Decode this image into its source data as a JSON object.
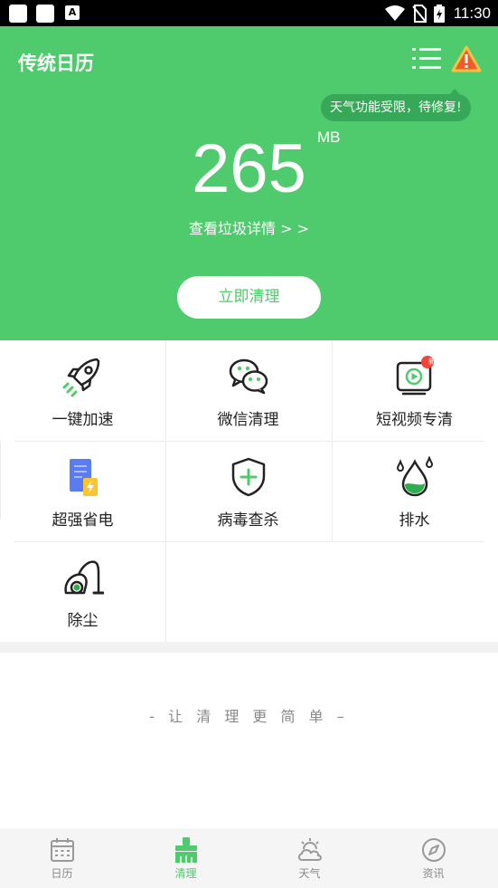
{
  "status_bar": {
    "time": "11:30",
    "icons": [
      "notification-square-icon",
      "notification-square-icon",
      "a-box-icon",
      "wifi-icon",
      "no-sim-icon",
      "battery-charging-icon"
    ]
  },
  "header": {
    "app_title": "传统日历",
    "tooltip": "天气功能受限，待修复!",
    "junk_size": "265",
    "junk_unit": "MB",
    "view_details": "查看垃圾详情 > >",
    "clean_button": "立即清理",
    "accent_color": "#4fca6c",
    "warning_color": "#f15a29"
  },
  "tools": [
    {
      "label": "一键加速",
      "icon": "rocket-icon"
    },
    {
      "label": "微信清理",
      "icon": "wechat-icon"
    },
    {
      "label": "短视频专清",
      "icon": "video-play-icon",
      "badge": "新"
    },
    {
      "label": "超强省电",
      "icon": "battery-saver-icon"
    },
    {
      "label": "病毒查杀",
      "icon": "shield-plus-icon"
    },
    {
      "label": "排水",
      "icon": "water-drop-icon"
    },
    {
      "label": "除尘",
      "icon": "vacuum-cleaner-icon"
    }
  ],
  "slogan": "- 让 清 理 更 简 单 –",
  "bottom_nav": [
    {
      "label": "日历",
      "icon": "calendar-icon",
      "active": false
    },
    {
      "label": "清理",
      "icon": "broom-icon",
      "active": true
    },
    {
      "label": "天气",
      "icon": "weather-icon",
      "active": false
    },
    {
      "label": "资讯",
      "icon": "compass-icon",
      "active": false
    }
  ]
}
